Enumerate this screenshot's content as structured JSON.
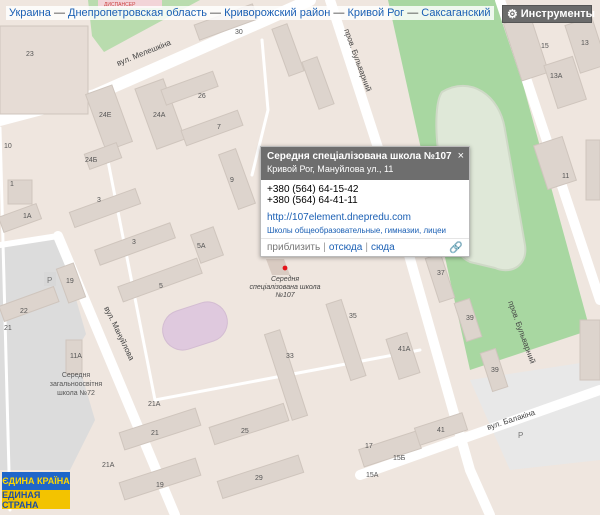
{
  "breadcrumb": {
    "items": [
      "Украина",
      "Днепропетровская область",
      "Криворожский район",
      "Кривой Рог",
      "Саксаганский"
    ],
    "separator": "—"
  },
  "tools_button": {
    "label": "Инструменты",
    "icon": "gear-icon"
  },
  "popup": {
    "title": "Середня спеціалізована школа №107",
    "address": "Кривой Рог, Мануйлова ул., 11",
    "close": "×",
    "phones": [
      "+380 (564) 64-15-42",
      "+380 (564) 64-41-11"
    ],
    "website": "http://107element.dnepredu.com",
    "category": "Школы общеобразовательные, гимназии, лицеи",
    "actions": [
      "приблизить",
      "отсюда",
      "сюда"
    ],
    "link_icon": "chain-link-icon"
  },
  "marker": {
    "label_lines": [
      "Середня",
      "спеціалізована школа",
      "№107"
    ],
    "color": "#e5141b"
  },
  "streets": {
    "meleshkina": "вул. Мелешкіна",
    "bulvarny": "пров. Бульварний",
    "bulvarny_2": "пров. Бульварний",
    "manuilova": "вул. Мануйлова",
    "balakina": "вул. Балакіна",
    "dispanser": "ДИСПАНСЕР"
  },
  "school72": {
    "number": "11А",
    "label_lines": [
      "Середня",
      "загальноосвітня",
      "школа №72"
    ]
  },
  "house_numbers": [
    "30",
    "23",
    "26",
    "24Е",
    "24А",
    "24Б",
    "7",
    "9",
    "3",
    "5А",
    "5",
    "1А",
    "1",
    "3",
    "15",
    "13",
    "13А",
    "11",
    "10",
    "19",
    "22",
    "Р",
    "21",
    "35",
    "41А",
    "33",
    "37",
    "39",
    "21А",
    "21",
    "25",
    "29",
    "41",
    "17",
    "19",
    "15А",
    "15Б",
    "Р"
  ],
  "logo": {
    "line1": "ЄДИНА КРАЇНА",
    "line2": "ЕДИНАЯ СТРАНА"
  },
  "colors": {
    "map_bg": "#efe6df",
    "building": "#ddd4cd",
    "park": "#a8d7a1",
    "water": "#c8d8e8",
    "popup_header": "#6e6e6e",
    "link": "#1a5fb4"
  }
}
